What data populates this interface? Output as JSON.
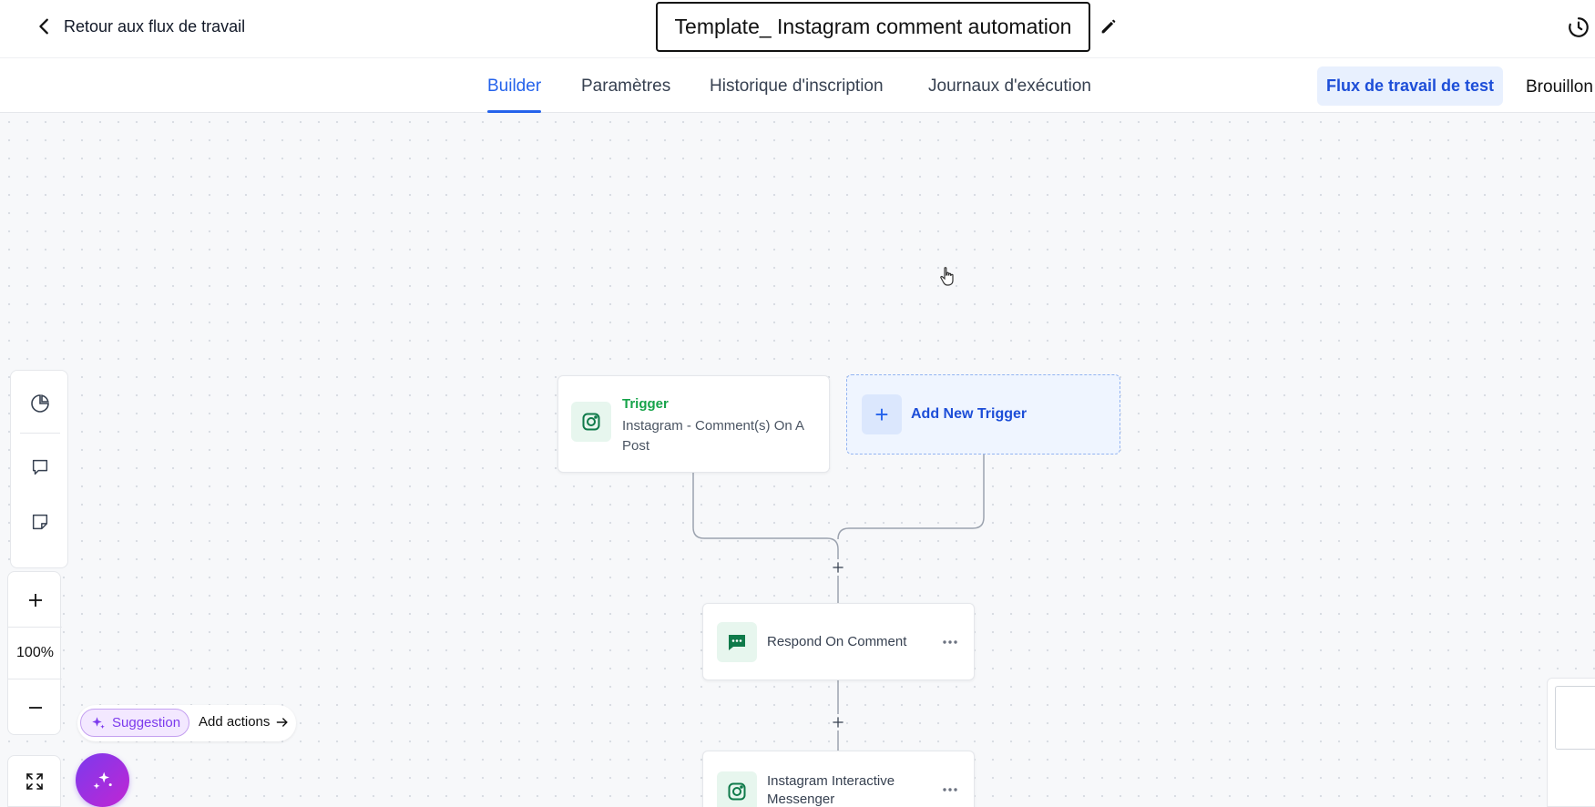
{
  "header": {
    "back_label": "Retour aux flux de travail",
    "title": "Template_ Instagram comment automation"
  },
  "tabs": [
    {
      "label": "Builder",
      "active": true
    },
    {
      "label": "Paramètres",
      "active": false
    },
    {
      "label": "Historique d'inscription",
      "active": false
    },
    {
      "label": "Journaux d'exécution",
      "active": false
    }
  ],
  "actions": {
    "test_label": "Flux de travail de test",
    "status_label": "Brouillon"
  },
  "workflow": {
    "trigger": {
      "title": "Trigger",
      "description": "Instagram - Comment(s) On A Post",
      "icon": "instagram-icon"
    },
    "add_trigger_label": "Add New Trigger",
    "steps": [
      {
        "label": "Respond On Comment",
        "icon": "chat-icon"
      },
      {
        "label": "Instagram Interactive Messenger",
        "icon": "instagram-icon"
      }
    ]
  },
  "toolbar": {
    "zoom_level": "100%"
  },
  "suggestion": {
    "pill_label": "Suggestion",
    "action_label": "Add actions"
  },
  "colors": {
    "accent": "#2563eb",
    "trigger_green": "#16a34a",
    "ai_purple": "#7c3aed"
  }
}
